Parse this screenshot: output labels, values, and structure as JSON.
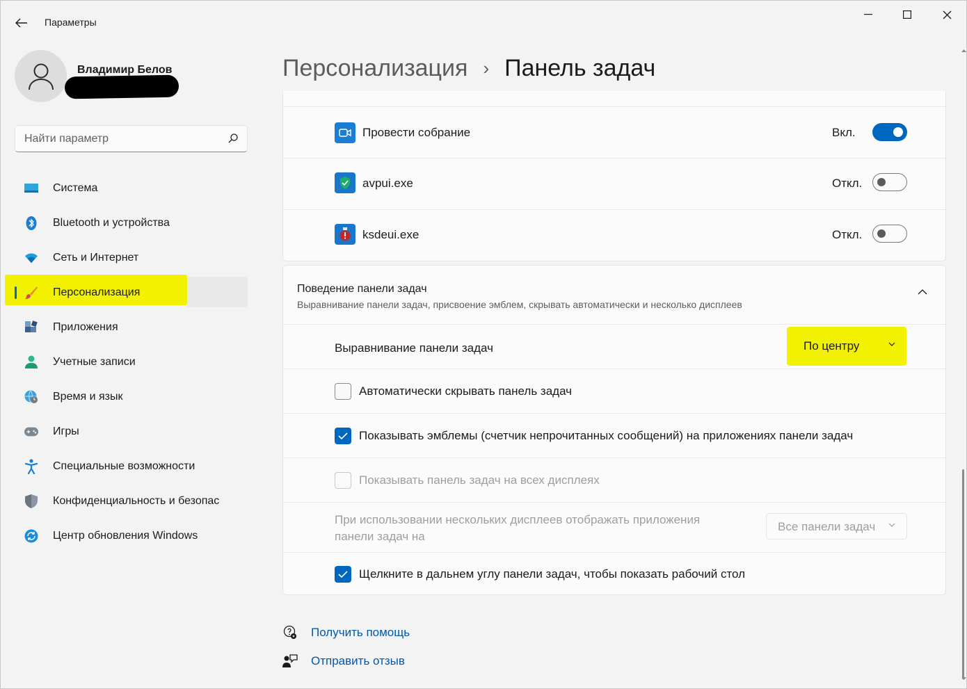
{
  "app": {
    "title": "Параметры"
  },
  "profile": {
    "name": "Владимир Белов"
  },
  "search": {
    "placeholder": "Найти параметр"
  },
  "nav": {
    "items": [
      {
        "label": "Система",
        "icon": "monitor-icon"
      },
      {
        "label": "Bluetooth и устройства",
        "icon": "bluetooth-icon"
      },
      {
        "label": "Сеть и Интернет",
        "icon": "wifi-icon"
      },
      {
        "label": "Персонализация",
        "icon": "brush-icon",
        "selected": true
      },
      {
        "label": "Приложения",
        "icon": "apps-icon"
      },
      {
        "label": "Учетные записи",
        "icon": "person-icon"
      },
      {
        "label": "Время и язык",
        "icon": "globe-clock-icon"
      },
      {
        "label": "Игры",
        "icon": "gamepad-icon"
      },
      {
        "label": "Специальные возможности",
        "icon": "accessibility-icon"
      },
      {
        "label": "Конфиденциальность и безопас",
        "icon": "shield-icon"
      },
      {
        "label": "Центр обновления Windows",
        "icon": "update-icon"
      }
    ]
  },
  "breadcrumb": {
    "parent": "Персонализация",
    "separator": "›",
    "current": "Панель задач"
  },
  "corner_overflow": {
    "items": [
      {
        "label": "Провести собрание",
        "state_label": "Вкл.",
        "on": true,
        "icon": "meet-now-icon"
      },
      {
        "label": "avpui.exe",
        "state_label": "Откл.",
        "on": false,
        "icon": "avp-shield-icon"
      },
      {
        "label": "ksdeui.exe",
        "state_label": "Откл.",
        "on": false,
        "icon": "ksde-icon"
      }
    ]
  },
  "behavior": {
    "title": "Поведение панели задач",
    "subtitle": "Выравнивание панели задач, присвоение эмблем, скрывать автоматически и несколько дисплеев",
    "alignment": {
      "label": "Выравнивание панели задач",
      "value": "По центру"
    },
    "auto_hide": {
      "label": "Автоматически скрывать панель задач",
      "checked": false
    },
    "badges": {
      "label": "Показывать эмблемы (счетчик непрочитанных сообщений) на приложениях панели задач",
      "checked": true
    },
    "all_displays": {
      "label": "Показывать панель задач на всех дисплеях",
      "checked": false,
      "disabled": true
    },
    "multi_display": {
      "label_line1": "При использовании нескольких дисплеев отображать приложения",
      "label_line2": "панели задач на",
      "value": "Все панели задач",
      "disabled": true
    },
    "far_corner": {
      "label": "Щелкните в дальнем углу панели задач, чтобы показать рабочий стол",
      "checked": true
    }
  },
  "help": {
    "get_help": "Получить помощь",
    "feedback": "Отправить отзыв"
  },
  "colors": {
    "accent": "#0067c0",
    "highlight": "#f2f200",
    "link": "#0058ad"
  }
}
